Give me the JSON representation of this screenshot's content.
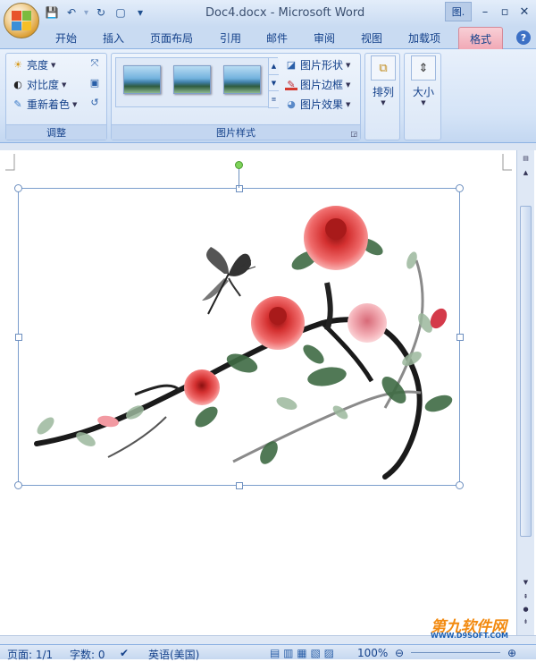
{
  "window": {
    "title": "Doc4.docx - Microsoft Word",
    "context_tab": "图.",
    "min": "–",
    "max": "▫",
    "close": "✕"
  },
  "qat": {
    "save": "💾",
    "undo": "↶",
    "redo": "↻",
    "new": "▢",
    "more": "▾"
  },
  "tabs": [
    "开始",
    "插入",
    "页面布局",
    "引用",
    "邮件",
    "审阅",
    "视图",
    "加载项",
    "格式"
  ],
  "active_tab": "格式",
  "help": "?",
  "adjust": {
    "label": "调整",
    "brightness": "亮度",
    "contrast": "对比度",
    "recolor": "重新着色"
  },
  "styles": {
    "label": "图片样式",
    "shape": "图片形状",
    "border": "图片边框",
    "effects": "图片效果"
  },
  "arrange": {
    "label": "排列"
  },
  "size": {
    "label": "大小"
  },
  "status": {
    "page": "页面: 1/1",
    "words": "字数: 0",
    "language": "英语(美国)",
    "zoom": "100%"
  },
  "watermark": {
    "text": "第九软件网",
    "url": "WWW.D9SOFT.COM"
  },
  "colors": {
    "active_tab": "#f1a9b6",
    "ribbon": "#d5e4f7",
    "accent": "#15428b"
  }
}
